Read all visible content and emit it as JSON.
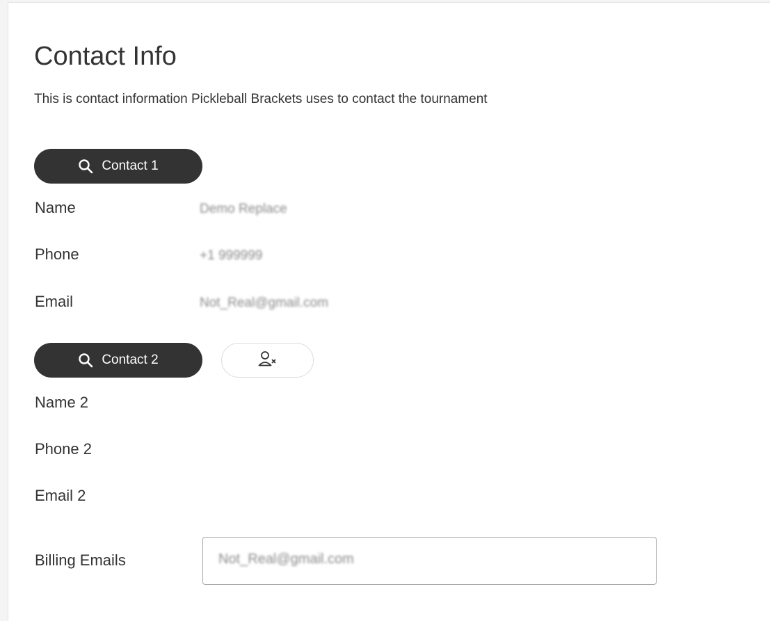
{
  "header": {
    "title": "Contact Info",
    "subtitle": "This is contact information Pickleball Brackets uses to contact the tournament"
  },
  "contact1": {
    "button_label": "Contact 1",
    "name_label": "Name",
    "phone_label": "Phone",
    "email_label": "Email",
    "name_value": "Demo Replace",
    "phone_value": "+1 999999",
    "email_value": "Not_Real@gmail.com"
  },
  "contact2": {
    "button_label": "Contact 2",
    "remove_icon": "user-remove-icon",
    "name_label": "Name 2",
    "phone_label": "Phone 2",
    "email_label": "Email 2"
  },
  "billing": {
    "label": "Billing Emails",
    "value": "Not_Real@gmail.com"
  },
  "colors": {
    "pill_bg": "#333333",
    "text": "#333333"
  }
}
